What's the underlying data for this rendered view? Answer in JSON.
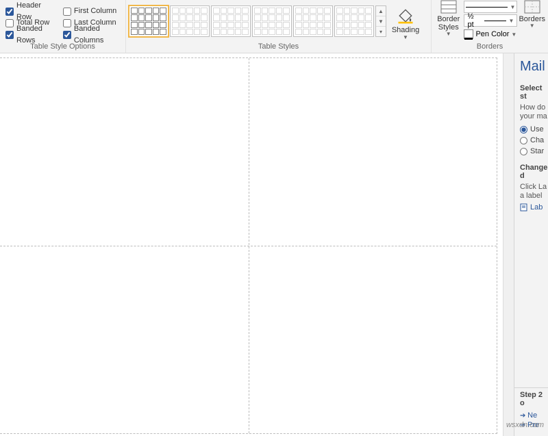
{
  "ribbon": {
    "options": {
      "group_label": "Table Style Options",
      "header_row": {
        "label": "Header Row",
        "checked": true
      },
      "total_row": {
        "label": "Total Row",
        "checked": false
      },
      "banded_rows": {
        "label": "Banded Rows",
        "checked": true
      },
      "first_column": {
        "label": "First Column",
        "checked": false
      },
      "last_column": {
        "label": "Last Column",
        "checked": false
      },
      "banded_cols": {
        "label": "Banded Columns",
        "checked": true
      }
    },
    "styles": {
      "group_label": "Table Styles",
      "shading_label": "Shading"
    },
    "borders": {
      "group_label": "Borders",
      "border_styles_label": "Border Styles",
      "weight_label": "½ pt",
      "pen_color_label": "Pen Color",
      "borders_btn_label": "Borders"
    }
  },
  "pane": {
    "title": "Mail",
    "section1": "Select st",
    "help_text": "How do\nyour ma",
    "radios": {
      "use": {
        "label": "Use",
        "checked": true
      },
      "cha": {
        "label": "Cha",
        "checked": false
      },
      "star": {
        "label": "Star",
        "checked": false
      }
    },
    "section2": "Change d",
    "change_text": "Click La\na label",
    "label_link": "Lab",
    "step": "Step 2 o",
    "next": "Ne",
    "prev": "Pre"
  },
  "watermark": "wsxdn.com"
}
